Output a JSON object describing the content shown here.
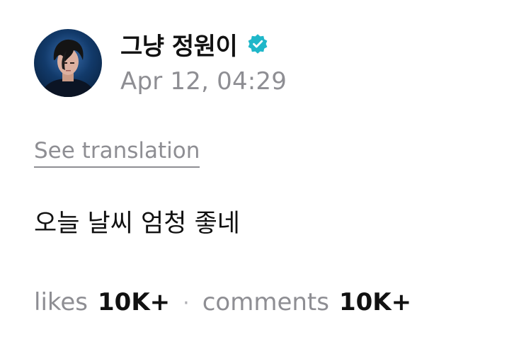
{
  "author": {
    "name": "그냥 정원이",
    "verified_icon": "verified-badge-icon",
    "badge_color": "#1fb7c9"
  },
  "post": {
    "timestamp": "Apr 12, 04:29",
    "translate_label": "See translation",
    "text": "오늘 날씨 엄청 좋네"
  },
  "stats": {
    "likes_label": "likes",
    "likes_count": "10K+",
    "separator": "·",
    "comments_label": "comments",
    "comments_count": "10K+"
  }
}
